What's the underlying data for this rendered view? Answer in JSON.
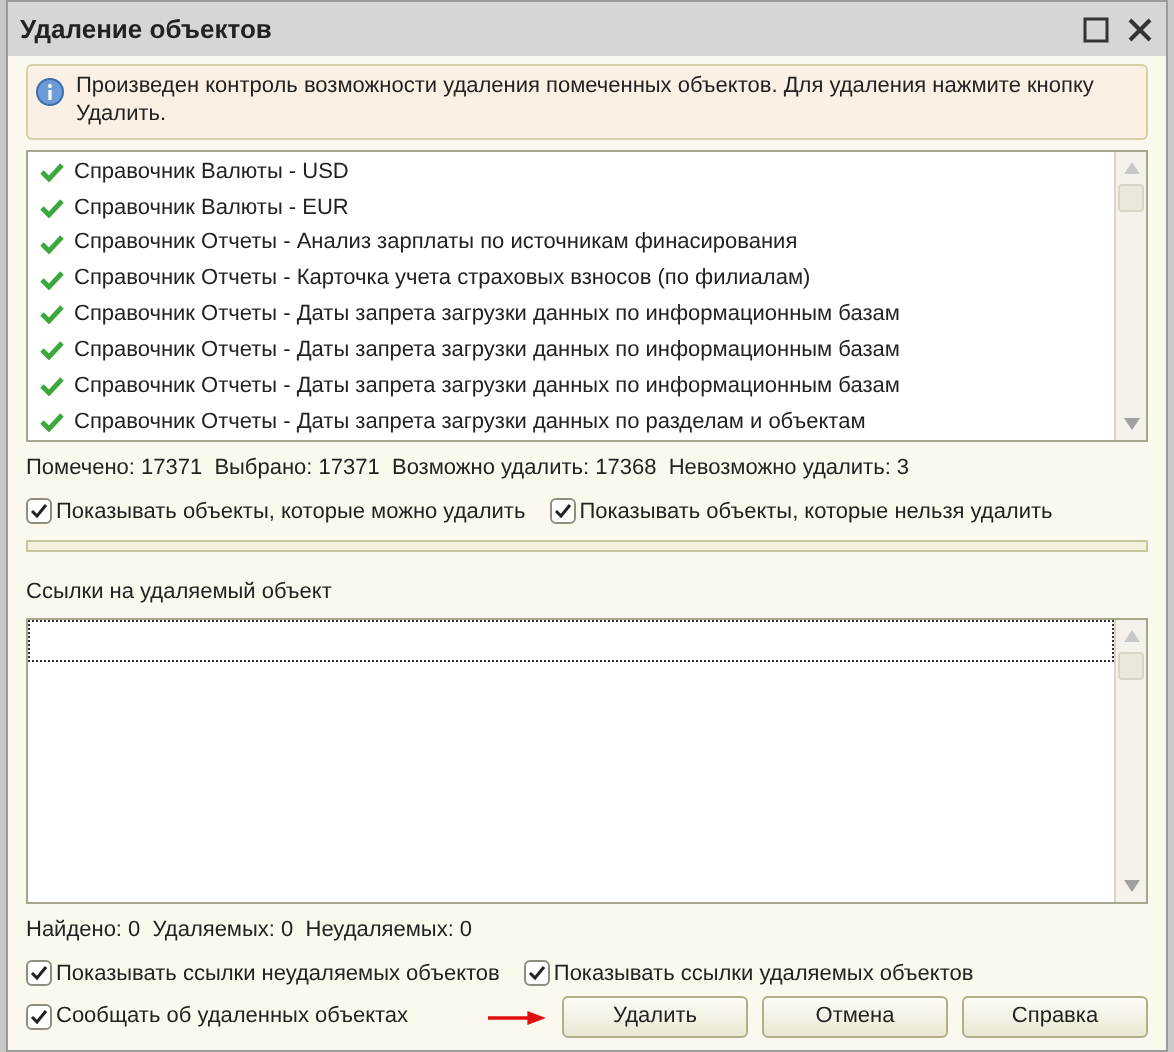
{
  "window": {
    "title": "Удаление объектов"
  },
  "info": "Произведен контроль возможности удаления помеченных объектов. Для удаления нажмите кнопку Удалить.",
  "objects": [
    "Справочник Валюты - USD",
    "Справочник Валюты - EUR",
    "Справочник Отчеты - Анализ зарплаты по источникам финасирования",
    "Справочник Отчеты - Карточка учета страховых взносов (по филиалам)",
    "Справочник Отчеты - Даты запрета загрузки данных по информационным базам",
    "Справочник Отчеты - Даты запрета загрузки данных по информационным базам",
    "Справочник Отчеты - Даты запрета загрузки данных по информационным базам",
    "Справочник Отчеты - Даты запрета загрузки данных по разделам и объектам"
  ],
  "object_stats": "Помечено: 17371  Выбрано: 17371  Возможно удалить: 17368  Невозможно удалить: 3",
  "object_filters": [
    {
      "label": "Показывать объекты, которые можно удалить",
      "checked": true
    },
    {
      "label": "Показывать объекты, которые нельзя удалить",
      "checked": true
    }
  ],
  "progress": {
    "level": 0
  },
  "references_label": "Ссылки на удаляемый объект",
  "reference_stats": "Найдено: 0  Удаляемых: 0  Неудаляемых: 0",
  "reference_filters": [
    {
      "label": "Показывать ссылки неудаляемых объектов",
      "checked": true
    },
    {
      "label": "Показывать ссылки удаляемых объектов",
      "checked": true
    }
  ],
  "notify": {
    "label": "Сообщать об удаленных объектах",
    "checked": true
  },
  "buttons": [
    "Удалить",
    "Отмена",
    "Справка"
  ]
}
